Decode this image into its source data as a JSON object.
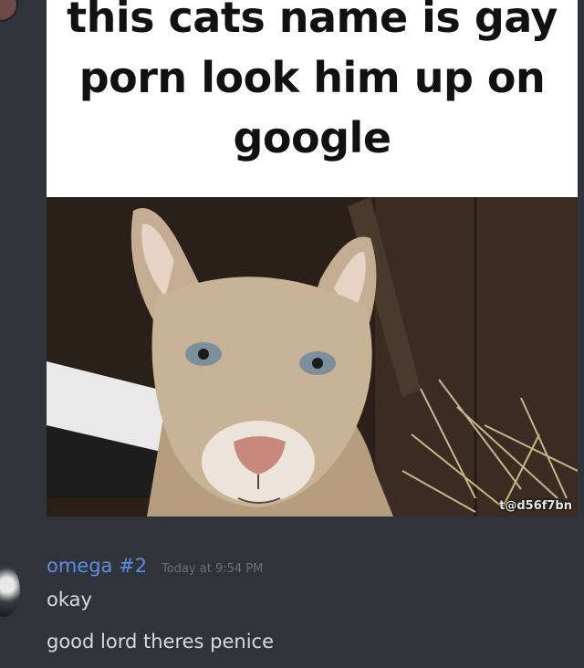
{
  "channel": {
    "attachment": {
      "caption": "this cats name is gay porn look him up on google",
      "photo_subject": "mountain lion",
      "watermark": "t@d56f7bn",
      "background_color": "#2f343b"
    },
    "message": {
      "author": "omega #2",
      "author_color": "#5f8be0",
      "timestamp": "Today at 9:54 PM",
      "lines": [
        "okay",
        "good lord theres penice"
      ]
    }
  }
}
